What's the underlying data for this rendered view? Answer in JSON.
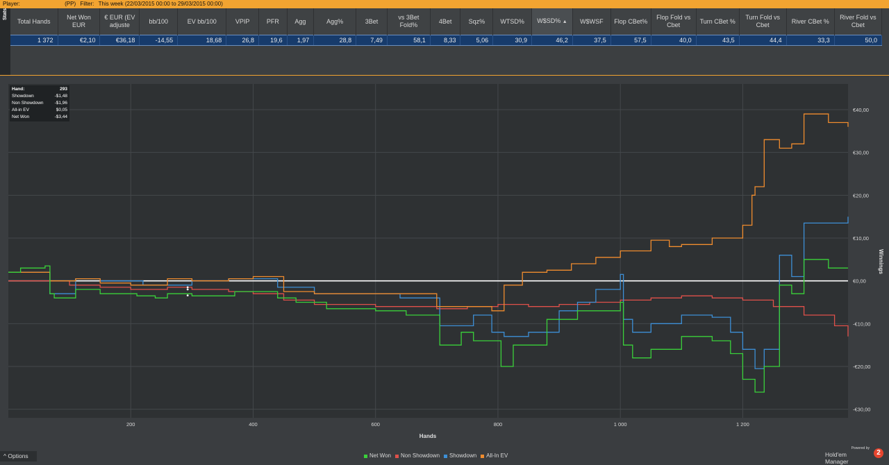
{
  "topbar": {
    "player_label": "Player:",
    "player_value": "(PP)",
    "filter_label": "Filter:",
    "filter_value": "This week (22/03/2015 00:00 to 29/03/2015 00:00)"
  },
  "stats": {
    "side_label": "Stats",
    "headers": [
      "Total Hands",
      "Net Won EUR",
      "€ EUR (EV adjuste",
      "bb/100",
      "EV bb/100",
      "VPIP",
      "PFR",
      "Agg",
      "Agg%",
      "3Bet",
      "vs 3Bet Fold%",
      "4Bet",
      "Sqz%",
      "WTSD%",
      "W$SD%",
      "W$WSF",
      "Flop CBet%",
      "Flop Fold vs Cbet",
      "Turn CBet %",
      "Turn Fold vs Cbet",
      "River CBet %",
      "River Fold vs Cbet"
    ],
    "sort_icon": "triangle-up-icon",
    "values": [
      "1 372",
      "€2,10",
      "€36,18",
      "-14,55",
      "18,68",
      "26,8",
      "19,6",
      "1,97",
      "28,8",
      "7,49",
      "58,1",
      "8,33",
      "5,06",
      "30,9",
      "46,2",
      "37,5",
      "57,5",
      "40,0",
      "43,5",
      "44,4",
      "33,3",
      "50,0"
    ]
  },
  "tooltip": {
    "rows": [
      {
        "label": "Hand:",
        "value": "293"
      },
      {
        "label": "Showdown",
        "value": "-$1,48"
      },
      {
        "label": "Non Showdown",
        "value": "-$1,96"
      },
      {
        "label": "All-in EV",
        "value": "$0,05"
      },
      {
        "label": "Net Won",
        "value": "-$3,44"
      }
    ]
  },
  "footer": {
    "options_label": "Options",
    "options_icon": "chevron-up-icon",
    "powered_by": "Powered by",
    "brand": "Hold'em Manager",
    "brand_badge": "2"
  },
  "colors": {
    "net_won": "#3ad13a",
    "non_showdown": "#e0504a",
    "showdown": "#3d8fd6",
    "allin_ev": "#f08c2e",
    "accent": "#f2a431"
  },
  "chart_data": {
    "type": "line",
    "xlabel": "Hands",
    "ylabel": "Winnings",
    "xlim": [
      0,
      1372
    ],
    "ylim": [
      -32,
      46
    ],
    "x_ticks": [
      200,
      400,
      600,
      800,
      1000,
      1200
    ],
    "x_tick_labels": [
      "200",
      "400",
      "600",
      "800",
      "1 000",
      "1 200"
    ],
    "y_ticks": [
      40,
      30,
      20,
      10,
      0,
      -10,
      -20,
      -30
    ],
    "y_tick_labels": [
      "€40,00",
      "€30,00",
      "€20,00",
      "€10,00",
      "€0,00",
      "-€10,00",
      "-€20,00",
      "-€30,00"
    ],
    "legend_position": "bottom-center",
    "series": [
      {
        "name": "Net Won",
        "x": [
          0,
          20,
          60,
          68,
          75,
          110,
          150,
          210,
          240,
          260,
          300,
          370,
          440,
          470,
          520,
          600,
          650,
          700,
          705,
          740,
          760,
          805,
          825,
          880,
          930,
          1000,
          1005,
          1020,
          1050,
          1100,
          1150,
          1180,
          1200,
          1220,
          1235,
          1260,
          1280,
          1300,
          1340,
          1372
        ],
        "y": [
          2,
          3,
          3.5,
          -3,
          -4,
          -2,
          -3,
          -3.5,
          -4,
          -3,
          -3.5,
          -2.5,
          -4,
          -5,
          -6.5,
          -7,
          -8,
          -8,
          -15,
          -12,
          -14,
          -20,
          -15,
          -9,
          -7,
          -5,
          -15,
          -18,
          -16,
          -13,
          -14,
          -17,
          -23,
          -26,
          -20,
          -1,
          -3,
          5,
          3,
          3
        ]
      },
      {
        "name": "Non Showdown",
        "x": [
          0,
          60,
          100,
          150,
          200,
          260,
          300,
          360,
          400,
          450,
          500,
          550,
          600,
          650,
          700,
          750,
          800,
          850,
          900,
          950,
          1000,
          1050,
          1100,
          1150,
          1200,
          1250,
          1300,
          1350,
          1372
        ],
        "y": [
          0,
          0,
          -1,
          -1.5,
          -2,
          -1.5,
          -2,
          -2.5,
          -3,
          -4.5,
          -5.5,
          -5.5,
          -6,
          -6,
          -6.5,
          -6,
          -5.5,
          -6,
          -5.5,
          -5,
          -4.5,
          -4,
          -3.5,
          -4,
          -4.5,
          -6,
          -8,
          -10.5,
          -13
        ]
      },
      {
        "name": "Showdown",
        "x": [
          0,
          60,
          68,
          110,
          150,
          220,
          300,
          360,
          440,
          500,
          560,
          640,
          700,
          705,
          760,
          790,
          810,
          850,
          900,
          930,
          960,
          1000,
          1005,
          1020,
          1050,
          1100,
          1150,
          1180,
          1200,
          1220,
          1235,
          1260,
          1280,
          1300,
          1340,
          1372
        ],
        "y": [
          2,
          2,
          -3,
          0.5,
          0,
          -1,
          0,
          0.5,
          -1.5,
          -3,
          -3,
          -4,
          -4,
          -10.5,
          -8,
          -12,
          -13,
          -12,
          -7,
          -5,
          -2,
          1.5,
          -9,
          -12,
          -10,
          -8,
          -8.5,
          -12,
          -16,
          -20.5,
          -16,
          6,
          1,
          13.5,
          13.5,
          15
        ]
      },
      {
        "name": "All-In EV",
        "x": [
          0,
          60,
          68,
          110,
          150,
          200,
          260,
          300,
          360,
          400,
          450,
          500,
          560,
          640,
          700,
          760,
          790,
          810,
          840,
          880,
          920,
          960,
          1000,
          1050,
          1080,
          1100,
          1150,
          1200,
          1215,
          1220,
          1235,
          1260,
          1280,
          1300,
          1340,
          1372
        ],
        "y": [
          2,
          2,
          0,
          0.5,
          -0.5,
          -1,
          0.5,
          0,
          0.5,
          1,
          -2.5,
          -3,
          -3,
          -3,
          -6,
          -6,
          -7,
          -1,
          2,
          2.5,
          4,
          5.5,
          7,
          9.5,
          8,
          8.5,
          10,
          13,
          20,
          22,
          33,
          31,
          32,
          39,
          37,
          36
        ]
      }
    ]
  }
}
